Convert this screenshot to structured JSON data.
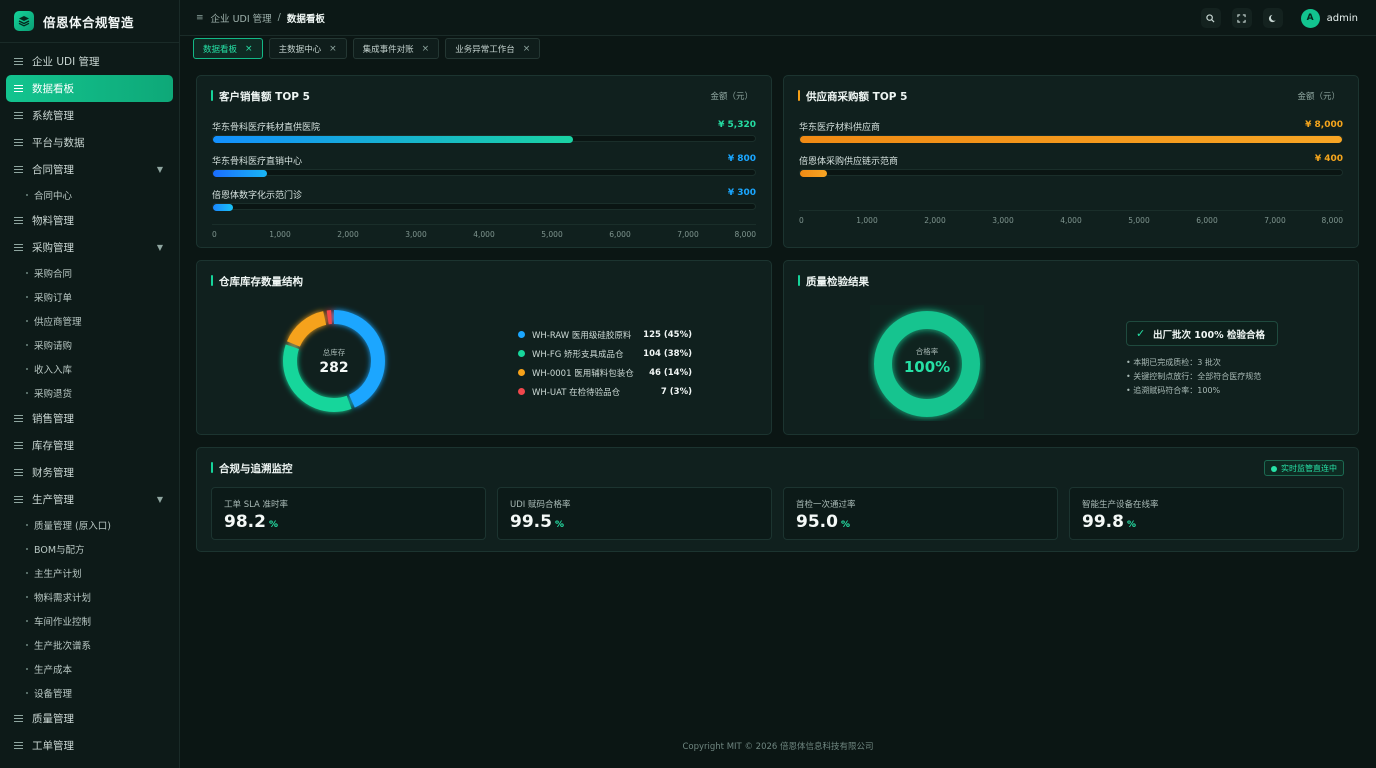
{
  "brand": {
    "title": "倍恩体合规智造"
  },
  "sidebar": {
    "items": [
      {
        "label": "企业 UDI 管理",
        "type": "item"
      },
      {
        "label": "数据看板",
        "type": "item",
        "active": true
      },
      {
        "label": "系统管理",
        "type": "item"
      },
      {
        "label": "平台与数据",
        "type": "item"
      },
      {
        "label": "合同管理",
        "type": "group"
      },
      {
        "label": "合同中心",
        "type": "sub"
      },
      {
        "label": "物料管理",
        "type": "item"
      },
      {
        "label": "采购管理",
        "type": "group"
      },
      {
        "label": "采购合同",
        "type": "sub"
      },
      {
        "label": "采购订单",
        "type": "sub"
      },
      {
        "label": "供应商管理",
        "type": "sub"
      },
      {
        "label": "采购请购",
        "type": "sub"
      },
      {
        "label": "收入入库",
        "type": "sub"
      },
      {
        "label": "采购退货",
        "type": "sub"
      },
      {
        "label": "销售管理",
        "type": "item"
      },
      {
        "label": "库存管理",
        "type": "item"
      },
      {
        "label": "财务管理",
        "type": "item"
      },
      {
        "label": "生产管理",
        "type": "group"
      },
      {
        "label": "质量管理 (原入口)",
        "type": "sub"
      },
      {
        "label": "BOM与配方",
        "type": "sub"
      },
      {
        "label": "主生产计划",
        "type": "sub"
      },
      {
        "label": "物料需求计划",
        "type": "sub"
      },
      {
        "label": "车间作业控制",
        "type": "sub"
      },
      {
        "label": "生产批次谱系",
        "type": "sub"
      },
      {
        "label": "生产成本",
        "type": "sub"
      },
      {
        "label": "设备管理",
        "type": "sub"
      },
      {
        "label": "质量管理",
        "type": "item"
      },
      {
        "label": "工单管理",
        "type": "item"
      }
    ]
  },
  "header": {
    "breadcrumb": [
      "企业 UDI 管理",
      "数据看板"
    ],
    "breadcrumb_sep": "/",
    "user": {
      "avatar": "A",
      "name": "admin"
    },
    "icons": [
      "search-icon",
      "fullscreen-icon",
      "theme-icon"
    ]
  },
  "tabs": [
    {
      "label": "数据看板",
      "active": true
    },
    {
      "label": "主数据中心"
    },
    {
      "label": "集成事件对账"
    },
    {
      "label": "业务异常工作台"
    }
  ],
  "customer_sales": {
    "title": "客户销售额 TOP 5",
    "unit": "金额（元）",
    "ticks": [
      "0",
      "1,000",
      "2,000",
      "3,000",
      "4,000",
      "5,000",
      "6,000",
      "7,000",
      "8,000"
    ],
    "rows": [
      {
        "name": "华东骨科医疗耗材直供医院",
        "value": 5320,
        "display": "¥ 5,320"
      },
      {
        "name": "华东骨科医疗直销中心",
        "value": 800,
        "display": "¥ 800"
      },
      {
        "name": "倍恩体数字化示范门诊",
        "value": 300,
        "display": "¥ 300"
      }
    ]
  },
  "supplier_purchase": {
    "title": "供应商采购额 TOP 5",
    "unit": "金额（元）",
    "ticks": [
      "0",
      "1,000",
      "2,000",
      "3,000",
      "4,000",
      "5,000",
      "6,000",
      "7,000",
      "8,000"
    ],
    "rows": [
      {
        "name": "华东医疗材料供应商",
        "value": 8000,
        "display": "¥ 8,000"
      },
      {
        "name": "倍恩体采购供应链示范商",
        "value": 400,
        "display": "¥ 400"
      }
    ]
  },
  "inventory": {
    "title": "仓库库存数量结构",
    "center_label": "总库存",
    "center_value": "282",
    "items": [
      {
        "name": "WH-RAW 医用级硅胶原料",
        "display": "125 (45%)",
        "value": 125,
        "color": "#1aa6ff"
      },
      {
        "name": "WH-FG 矫形支具成品仓",
        "display": "104 (38%)",
        "value": 104,
        "color": "#17d69b"
      },
      {
        "name": "WH-0001 医用辅料包装仓",
        "display": "46 (14%)",
        "value": 46,
        "color": "#f6a21a"
      },
      {
        "name": "WH-UAT 在检待验品仓",
        "display": "7 (3%)",
        "value": 7,
        "color": "#f0474c"
      }
    ]
  },
  "quality": {
    "title": "质量检验结果",
    "center_label": "合格率",
    "center_value": "100%",
    "rate": 1.0,
    "badge": "出厂批次 100% 检验合格",
    "lines": [
      "• 本期已完成质检：3 批次",
      "• 关键控制点放行：全部符合医疗规范",
      "• 追溯赋码符合率：100%"
    ]
  },
  "compliance": {
    "title": "合规与追溯监控",
    "live": "实时监管直连中",
    "metrics": [
      {
        "label": "工单 SLA 准时率",
        "value": "98.2",
        "unit": "%"
      },
      {
        "label": "UDI 赋码合格率",
        "value": "99.5",
        "unit": "%"
      },
      {
        "label": "首检一次通过率",
        "value": "95.0",
        "unit": "%"
      },
      {
        "label": "智能生产设备在线率",
        "value": "99.8",
        "unit": "%"
      }
    ]
  },
  "colors": {
    "accent": "#16d39a",
    "orange": "#f59f17",
    "blue": "#1aa6ff"
  },
  "footer": {
    "text": "Copyright MIT © 2026 倍恩体信息科技有限公司"
  }
}
